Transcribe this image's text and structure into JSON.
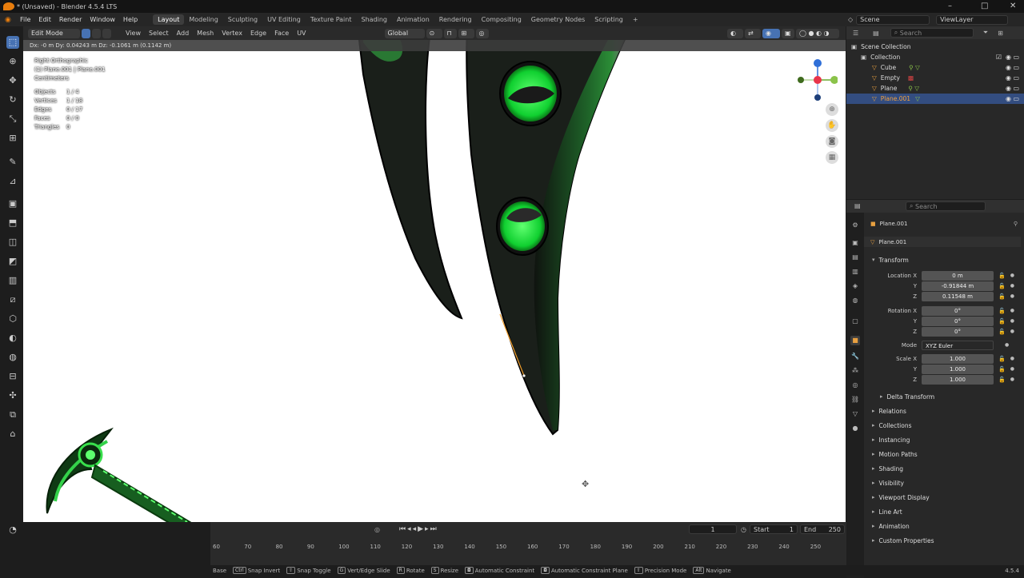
{
  "app": {
    "title": "* (Unsaved) - Blender 4.5.4 LTS",
    "window_controls": [
      "–",
      "□",
      "✕"
    ]
  },
  "menus": [
    "File",
    "Edit",
    "Render",
    "Window",
    "Help"
  ],
  "workspaces": [
    "Layout",
    "Modeling",
    "Sculpting",
    "UV Editing",
    "Texture Paint",
    "Shading",
    "Animation",
    "Rendering",
    "Compositing",
    "Geometry Nodes",
    "Scripting",
    "+"
  ],
  "scene": "Scene",
  "view_layer": "ViewLayer",
  "viewport": {
    "mode": "Edit Mode",
    "menus": [
      "View",
      "Select",
      "Add",
      "Mesh",
      "Vertex",
      "Edge",
      "Face",
      "UV"
    ],
    "orientation": "Global",
    "status": "Dx: -0 m   Dy: 0.04243 m   Dz: -0.1061 m (0.1142 m)",
    "overlay": {
      "view": "Right Orthographic",
      "object": "(1) Plane.001 | Plane.001",
      "units": "Centimeters"
    },
    "stats": [
      {
        "k": "Objects",
        "v": "1 / 4"
      },
      {
        "k": "Vertices",
        "v": "1 / 18"
      },
      {
        "k": "Edges",
        "v": "0 / 17"
      },
      {
        "k": "Faces",
        "v": "0 / 0"
      },
      {
        "k": "Triangles",
        "v": "0"
      }
    ],
    "colors": {
      "blade_dark": "#1a1f1a",
      "blade_green": "#2d8f3a",
      "eye": "#22dd3a",
      "edge_orange": "#f0a030"
    }
  },
  "timeline": {
    "current": "1",
    "start_label": "Start",
    "start": "1",
    "end_label": "End",
    "end": "250",
    "ticks": [
      "60",
      "70",
      "80",
      "90",
      "100",
      "110",
      "120",
      "130",
      "140",
      "150",
      "160",
      "170",
      "180",
      "190",
      "200",
      "210",
      "220",
      "230",
      "240",
      "250"
    ]
  },
  "statusbar": [
    {
      "key": "",
      "label": "Base"
    },
    {
      "key": "Ctrl",
      "label": "Snap Invert"
    },
    {
      "key": "",
      "label": "Snap Toggle"
    },
    {
      "key": "G",
      "label": "Vert/Edge Slide"
    },
    {
      "key": "R",
      "label": "Rotate"
    },
    {
      "key": "S",
      "label": "Resize"
    },
    {
      "key": "",
      "label": "Automatic Constraint"
    },
    {
      "key": "",
      "label": "Automatic Constraint Plane"
    },
    {
      "key": "",
      "label": "Precision Mode"
    },
    {
      "key": "Alt",
      "label": "Navigate"
    }
  ],
  "version": "4.5.4",
  "outliner": {
    "search": "Search",
    "root": "Scene Collection",
    "collection": "Collection",
    "items": [
      {
        "name": "Cube",
        "selected": false
      },
      {
        "name": "Empty",
        "selected": false
      },
      {
        "name": "Plane",
        "selected": false
      },
      {
        "name": "Plane.001",
        "selected": true
      }
    ]
  },
  "properties": {
    "search": "Search",
    "object_name": "Plane.001",
    "data_name": "Plane.001",
    "transform_label": "Transform",
    "location": {
      "label": "Location X",
      "x": "0 m",
      "y": "-0.91844 m",
      "z": "0.11548 m"
    },
    "rotation": {
      "label": "Rotation X",
      "x": "0°",
      "y": "0°",
      "z": "0°"
    },
    "mode_label": "Mode",
    "mode": "XYZ Euler",
    "scale": {
      "label": "Scale X",
      "x": "1.000",
      "y": "1.000",
      "z": "1.000"
    },
    "axis_y": "Y",
    "axis_z": "Z",
    "delta": "Delta Transform",
    "sections": [
      "Relations",
      "Collections",
      "Instancing",
      "Motion Paths",
      "Shading",
      "Visibility",
      "Viewport Display",
      "Line Art",
      "Animation",
      "Custom Properties"
    ]
  }
}
